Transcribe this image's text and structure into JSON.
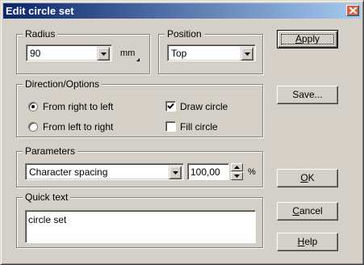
{
  "window": {
    "title": "Edit circle set"
  },
  "radius": {
    "label": "Radius",
    "value": "90",
    "unit": "mm"
  },
  "position": {
    "label": "Position",
    "value": "Top"
  },
  "direction": {
    "label": "Direction/Options",
    "options": [
      {
        "label": "From right to left",
        "selected": true
      },
      {
        "label": "From left to right",
        "selected": false
      }
    ],
    "draw_circle": {
      "label": "Draw circle",
      "checked": true
    },
    "fill_circle": {
      "label": "Fill circle",
      "checked": false
    }
  },
  "parameters": {
    "label": "Parameters",
    "value": "Character spacing",
    "number": "100,00",
    "unit": "%"
  },
  "quick_text": {
    "label": "Quick text",
    "value": "circle set"
  },
  "buttons": {
    "apply": {
      "pre": "",
      "mnemonic": "A",
      "post": "pply"
    },
    "save": "Save...",
    "ok": {
      "pre": "",
      "mnemonic": "O",
      "post": "K"
    },
    "cancel": {
      "pre": "",
      "mnemonic": "C",
      "post": "ancel"
    },
    "help": {
      "pre": "",
      "mnemonic": "H",
      "post": "elp"
    }
  }
}
